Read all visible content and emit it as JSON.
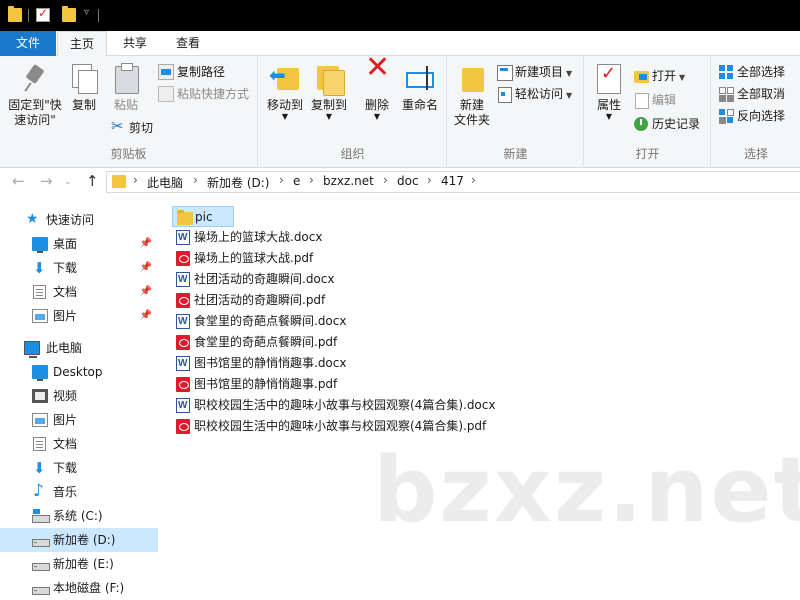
{
  "tabs": {
    "file": "文件",
    "home": "主页",
    "share": "共享",
    "view": "查看"
  },
  "ribbon": {
    "clipboard": {
      "label": "剪贴板",
      "pin": "固定到\"快\n速访问\"",
      "copy": "复制",
      "paste": "粘贴",
      "copy_path": "复制路径",
      "paste_shortcut": "粘贴快捷方式",
      "cut": "剪切"
    },
    "organize": {
      "label": "组织",
      "move_to": "移动到",
      "copy_to": "复制到",
      "delete": "删除",
      "rename": "重命名"
    },
    "new": {
      "label": "新建",
      "new_folder": "新建\n文件夹",
      "new_item": "新建项目",
      "easy_access": "轻松访问"
    },
    "open": {
      "label": "打开",
      "properties": "属性",
      "open": "打开",
      "edit": "编辑",
      "history": "历史记录"
    },
    "select": {
      "label": "选择",
      "select_all": "全部选择",
      "select_none": "全部取消",
      "invert": "反向选择"
    }
  },
  "address": {
    "crumbs": [
      "此电脑",
      "新加卷 (D:)",
      "e",
      "bzxz.net",
      "doc",
      "417"
    ]
  },
  "nav": {
    "quick_access": "快速访问",
    "qa_items": [
      {
        "label": "桌面",
        "icon": "desktop-icon"
      },
      {
        "label": "下载",
        "icon": "download-icon"
      },
      {
        "label": "文档",
        "icon": "documents-icon"
      },
      {
        "label": "图片",
        "icon": "pictures-icon"
      }
    ],
    "this_pc": "此电脑",
    "pc_items": [
      {
        "label": "Desktop",
        "icon": "desktop-icon"
      },
      {
        "label": "视频",
        "icon": "video-icon"
      },
      {
        "label": "图片",
        "icon": "pictures-icon"
      },
      {
        "label": "文档",
        "icon": "documents-icon"
      },
      {
        "label": "下载",
        "icon": "download-icon"
      },
      {
        "label": "音乐",
        "icon": "music-icon"
      },
      {
        "label": "系统 (C:)",
        "icon": "system-drive-icon"
      },
      {
        "label": "新加卷 (D:)",
        "icon": "drive-icon",
        "selected": true
      },
      {
        "label": "新加卷 (E:)",
        "icon": "drive-icon"
      },
      {
        "label": "本地磁盘 (F:)",
        "icon": "drive-icon"
      }
    ]
  },
  "files": [
    {
      "name": "pic",
      "type": "folder",
      "selected": true
    },
    {
      "name": "操场上的篮球大战.docx",
      "type": "docx"
    },
    {
      "name": "操场上的篮球大战.pdf",
      "type": "pdf"
    },
    {
      "name": "社团活动的奇趣瞬间.docx",
      "type": "docx"
    },
    {
      "name": "社团活动的奇趣瞬间.pdf",
      "type": "pdf"
    },
    {
      "name": "食堂里的奇葩点餐瞬间.docx",
      "type": "docx"
    },
    {
      "name": "食堂里的奇葩点餐瞬间.pdf",
      "type": "pdf"
    },
    {
      "name": "图书馆里的静悄悄趣事.docx",
      "type": "docx"
    },
    {
      "name": "图书馆里的静悄悄趣事.pdf",
      "type": "pdf"
    },
    {
      "name": "职校校园生活中的趣味小故事与校园观察(4篇合集).docx",
      "type": "docx"
    },
    {
      "name": "职校校园生活中的趣味小故事与校园观察(4篇合集).pdf",
      "type": "pdf"
    }
  ],
  "watermark": "bzxz.net"
}
